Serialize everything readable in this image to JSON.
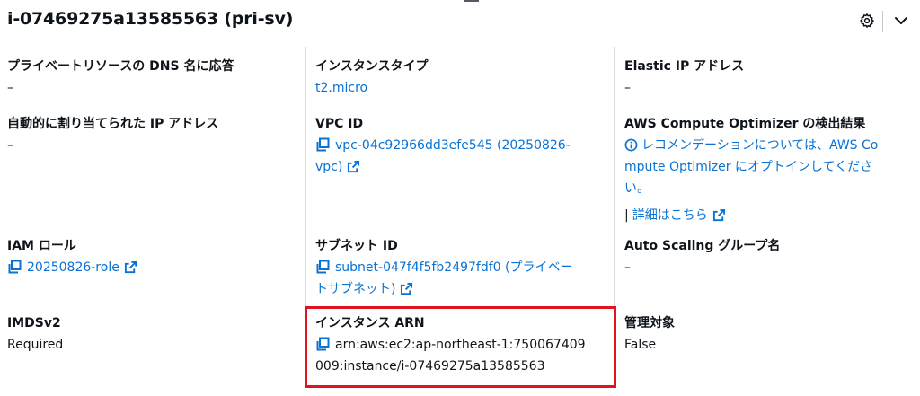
{
  "header": {
    "title": "i-07469275a13585563 (pri-sv)"
  },
  "col1": {
    "dns": {
      "label": "プライベートリソースの DNS 名に応答",
      "value": "–"
    },
    "auto_ip": {
      "label": "自動的に割り当てられた IP アドレス",
      "value": "–"
    },
    "iam": {
      "label": "IAM ロール",
      "value": "20250826-role"
    },
    "imds": {
      "label": "IMDSv2",
      "value": "Required"
    }
  },
  "col2": {
    "instance_type": {
      "label": "インスタンスタイプ",
      "value": "t2.micro"
    },
    "vpc": {
      "label": "VPC ID",
      "value_line1": "vpc-04c92966dd3efe545 (20250826-",
      "value_line2": "vpc)"
    },
    "subnet": {
      "label": "サブネット ID",
      "value_line1": "subnet-047f4f5fb2497fdf0 (プライベー",
      "value_line2": "トサブネット)"
    },
    "arn": {
      "label": "インスタンス ARN",
      "value_line1": "arn:aws:ec2:ap-northeast-1:750067409",
      "value_line2": "009:instance/i-07469275a13585563"
    }
  },
  "col3": {
    "elastic_ip": {
      "label": "Elastic IP アドレス",
      "value": "–"
    },
    "optimizer": {
      "label": "AWS Compute Optimizer の検出結果",
      "line1": "レコメンデーションについては、AWS Co",
      "line2": "mpute Optimizer にオプトインしてくださ",
      "line3": "い。",
      "details_pipe": "|",
      "details_link": "詳細はこちら"
    },
    "asg": {
      "label": "Auto Scaling グループ名",
      "value": "–"
    },
    "managed": {
      "label": "管理対象",
      "value": "False"
    }
  },
  "icons": {
    "settings": "gear-icon",
    "collapse": "chevron-down-icon",
    "copy": "copy-icon",
    "external": "external-link-icon",
    "info": "info-icon"
  },
  "colors": {
    "link": "#0972d3",
    "text": "#0f141a",
    "highlight": "#e0141e"
  }
}
